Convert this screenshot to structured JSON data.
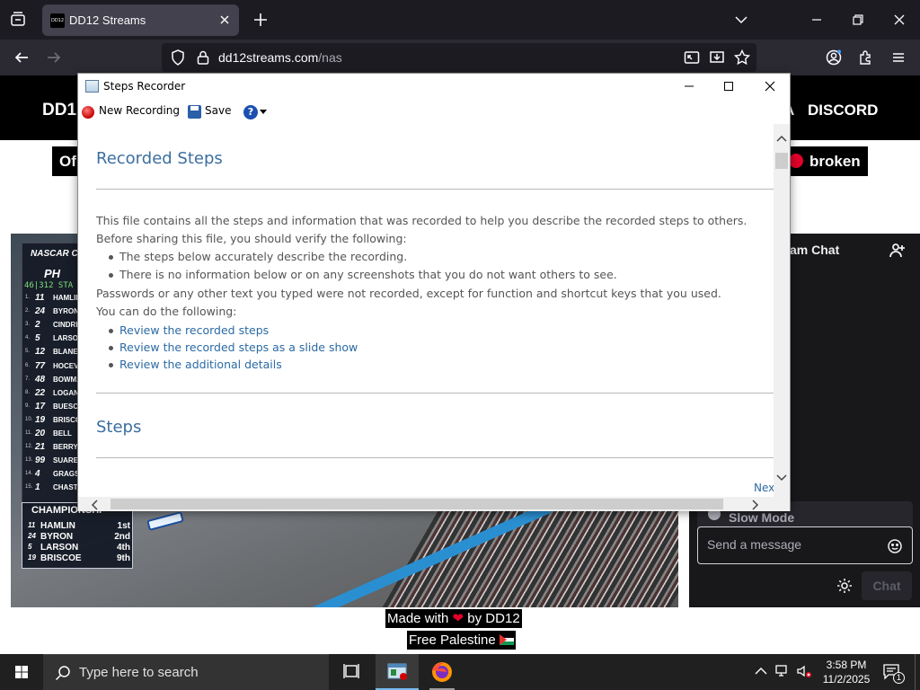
{
  "browser": {
    "tab": {
      "favicon_text": "DD12",
      "title": "DD12 Streams"
    },
    "url": {
      "domain": "dd12streams.com",
      "path": "/nas"
    }
  },
  "site": {
    "logo_partial": "DD1",
    "nav_partial": "A",
    "nav_discord": "DISCORD",
    "banner_left_partial": "Of",
    "banner_right": "broken",
    "chat_title_partial": "am Chat",
    "slow_mode": "Slow Mode",
    "chat_placeholder": "Send a message",
    "chat_button": "Chat",
    "footer_made_prefix": "Made with",
    "footer_made_suffix": "by DD12",
    "footer_free": "Free Palestine",
    "accent_red": "#e4002b"
  },
  "broadcast": {
    "series_partial": "NASCAR C",
    "track_partial": "PH",
    "lap_info": "46|312  STA",
    "running_order": [
      {
        "pos": "1.",
        "num": "11",
        "name": "HAMLIN"
      },
      {
        "pos": "2.",
        "num": "24",
        "name": "BYRON"
      },
      {
        "pos": "3.",
        "num": "2",
        "name": "CINDRI"
      },
      {
        "pos": "4.",
        "num": "5",
        "name": "LARSON"
      },
      {
        "pos": "5.",
        "num": "12",
        "name": "BLANEY"
      },
      {
        "pos": "6.",
        "num": "77",
        "name": "HOCEVA"
      },
      {
        "pos": "7.",
        "num": "48",
        "name": "BOWMA"
      },
      {
        "pos": "8.",
        "num": "22",
        "name": "LOGANO"
      },
      {
        "pos": "9.",
        "num": "17",
        "name": "BUESCI"
      },
      {
        "pos": "10.",
        "num": "19",
        "name": "BRISCO"
      },
      {
        "pos": "11.",
        "num": "20",
        "name": "BELL"
      },
      {
        "pos": "12.",
        "num": "21",
        "name": "BERRY"
      },
      {
        "pos": "13.",
        "num": "99",
        "name": "SUAREZ"
      },
      {
        "pos": "14.",
        "num": "4",
        "name": "GRAGS"
      },
      {
        "pos": "15.",
        "num": "1",
        "name": "CHASTA"
      }
    ],
    "championship_title": "CHAMPIONSHI",
    "championship": [
      {
        "num": "11",
        "name": "HAMLIN",
        "place": "1st"
      },
      {
        "num": "24",
        "name": "BYRON",
        "place": "2nd"
      },
      {
        "num": "5",
        "name": "LARSON",
        "place": "4th"
      },
      {
        "num": "19",
        "name": "BRISCOE",
        "place": "9th"
      }
    ]
  },
  "recorder": {
    "title": "Steps Recorder",
    "toolbar": {
      "new_recording": "New Recording",
      "save": "Save",
      "help_icon": "help-icon"
    },
    "heading_recorded": "Recorded Steps",
    "intro": "This file contains all the steps and information that was recorded to help you describe the recorded steps to others.",
    "verify_prompt": "Before sharing this file, you should verify the following:",
    "verify_items": [
      "The steps below accurately describe the recording.",
      "There is no information below or on any screenshots that you do not want others to see."
    ],
    "passwords_note": "Passwords or any other text you typed were not recorded, except for function and shortcut keys that you used.",
    "can_do": "You can do the following:",
    "links": [
      "Review the recorded steps",
      "Review the recorded steps as a slide show",
      "Review the additional details"
    ],
    "heading_steps": "Steps",
    "next_partial": "Nex"
  },
  "taskbar": {
    "search_placeholder": "Type here to search",
    "time": "3:58 PM",
    "date": "11/2/2025",
    "notification_count": "1"
  }
}
